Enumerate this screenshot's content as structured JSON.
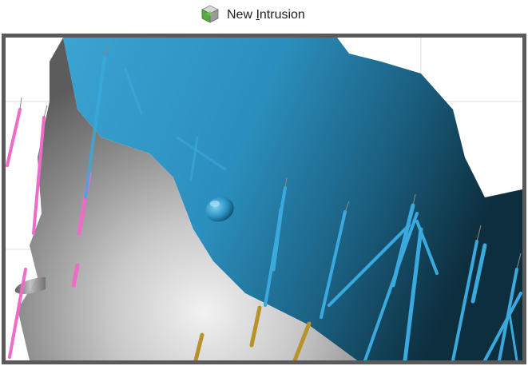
{
  "toolbar": {
    "new_intrusion": {
      "label_pre": "New ",
      "label_mnemonic": "I",
      "label_post": "ntrusion",
      "icon": "intrusion-cube-icon"
    }
  },
  "viewport": {
    "colors": {
      "frame": "#5a5a5a",
      "background": "#ffffff",
      "blue_surface": "#2a90bd",
      "blue_surface_dark": "#0f3a4e",
      "grey_surface": "#9a9a9a",
      "grey_surface_light": "#e8e8e8",
      "drillhole_blue": "#3aa9dd",
      "drillhole_pink": "#f06ac8",
      "drillhole_gold": "#b8922a",
      "grid_line": "#d8d8d8"
    }
  }
}
